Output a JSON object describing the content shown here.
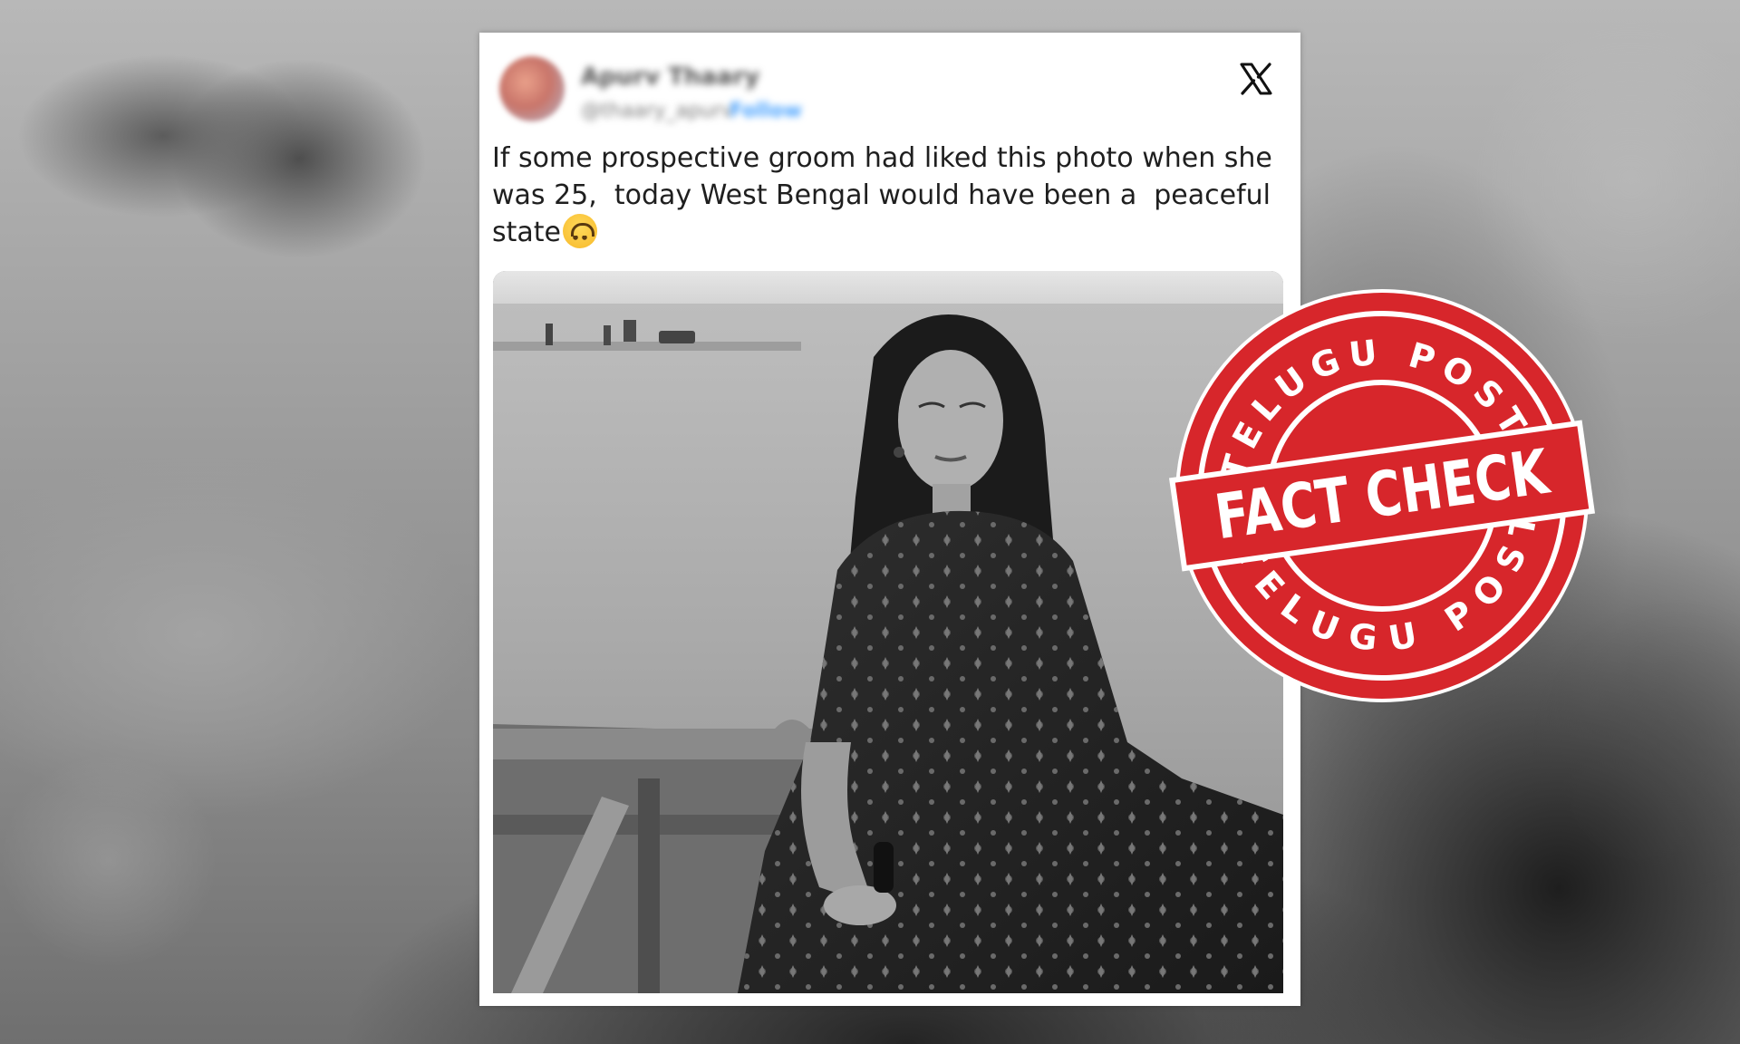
{
  "tweet": {
    "user_name": "Apurv Thaary",
    "user_handle": "@thaary_apurv",
    "follow_label": "Follow",
    "text": "If some prospective groom had liked this photo when she was 25,  today West Bengal would have been a  peaceful state",
    "emoji": "upside-down-face",
    "platform_logo": "x-logo-icon"
  },
  "stamp": {
    "top_text": "TELUGU POST",
    "center_text": "FACT CHECK",
    "bottom_text": "TELUGU POST",
    "color": "#d7262b"
  },
  "colors": {
    "card_background": "#ffffff",
    "text": "#1f1f1f",
    "follow_link": "#4aa3ff"
  }
}
